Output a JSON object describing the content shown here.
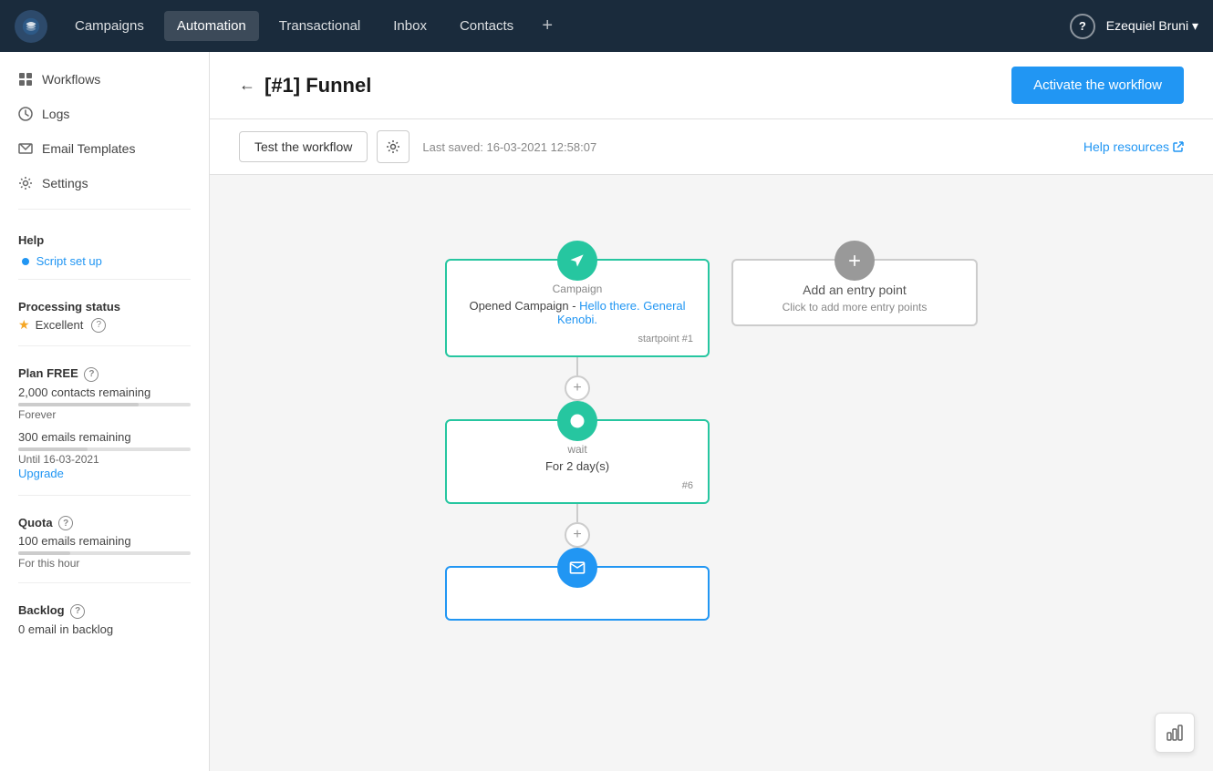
{
  "topnav": {
    "logo_alt": "Sendinblue logo",
    "items": [
      {
        "label": "Campaigns",
        "active": false
      },
      {
        "label": "Automation",
        "active": true
      },
      {
        "label": "Transactional",
        "active": false
      },
      {
        "label": "Inbox",
        "active": false
      },
      {
        "label": "Contacts",
        "active": false
      }
    ],
    "help_label": "?",
    "user_label": "Ezequiel Bruni ▾"
  },
  "sidebar": {
    "nav_items": [
      {
        "label": "Workflows",
        "icon": "grid"
      },
      {
        "label": "Logs",
        "icon": "clock"
      },
      {
        "label": "Email Templates",
        "icon": "send"
      },
      {
        "label": "Settings",
        "icon": "gear"
      }
    ],
    "help_section": "Help",
    "script_setup_label": "Script set up",
    "processing_status_label": "Processing status",
    "processing_status_value": "Excellent",
    "plan_label": "Plan FREE",
    "contacts_remaining": "2,000 contacts remaining",
    "contacts_period": "Forever",
    "emails_remaining": "300 emails remaining",
    "emails_until": "Until 16-03-2021",
    "upgrade_label": "Upgrade",
    "quota_label": "Quota",
    "quota_emails": "100 emails remaining",
    "quota_period": "For this hour",
    "backlog_label": "Backlog",
    "backlog_value": "0 email in backlog"
  },
  "page": {
    "back_label": "←",
    "title": "[#1] Funnel",
    "activate_label": "Activate the workflow",
    "test_label": "Test the workflow",
    "last_saved": "Last saved: 16-03-2021 12:58:07",
    "help_resources_label": "Help resources"
  },
  "workflow": {
    "node1": {
      "type": "Campaign",
      "content_prefix": "Opened Campaign -",
      "content_link": "Hello there. General Kenobi.",
      "badge": "startpoint #1"
    },
    "node_add": {
      "title": "Add an entry point",
      "subtitle": "Click to add more entry points"
    },
    "node2": {
      "type": "wait",
      "content": "For 2 day(s)",
      "badge": "#6"
    },
    "node3": {
      "type": "send_email"
    }
  }
}
